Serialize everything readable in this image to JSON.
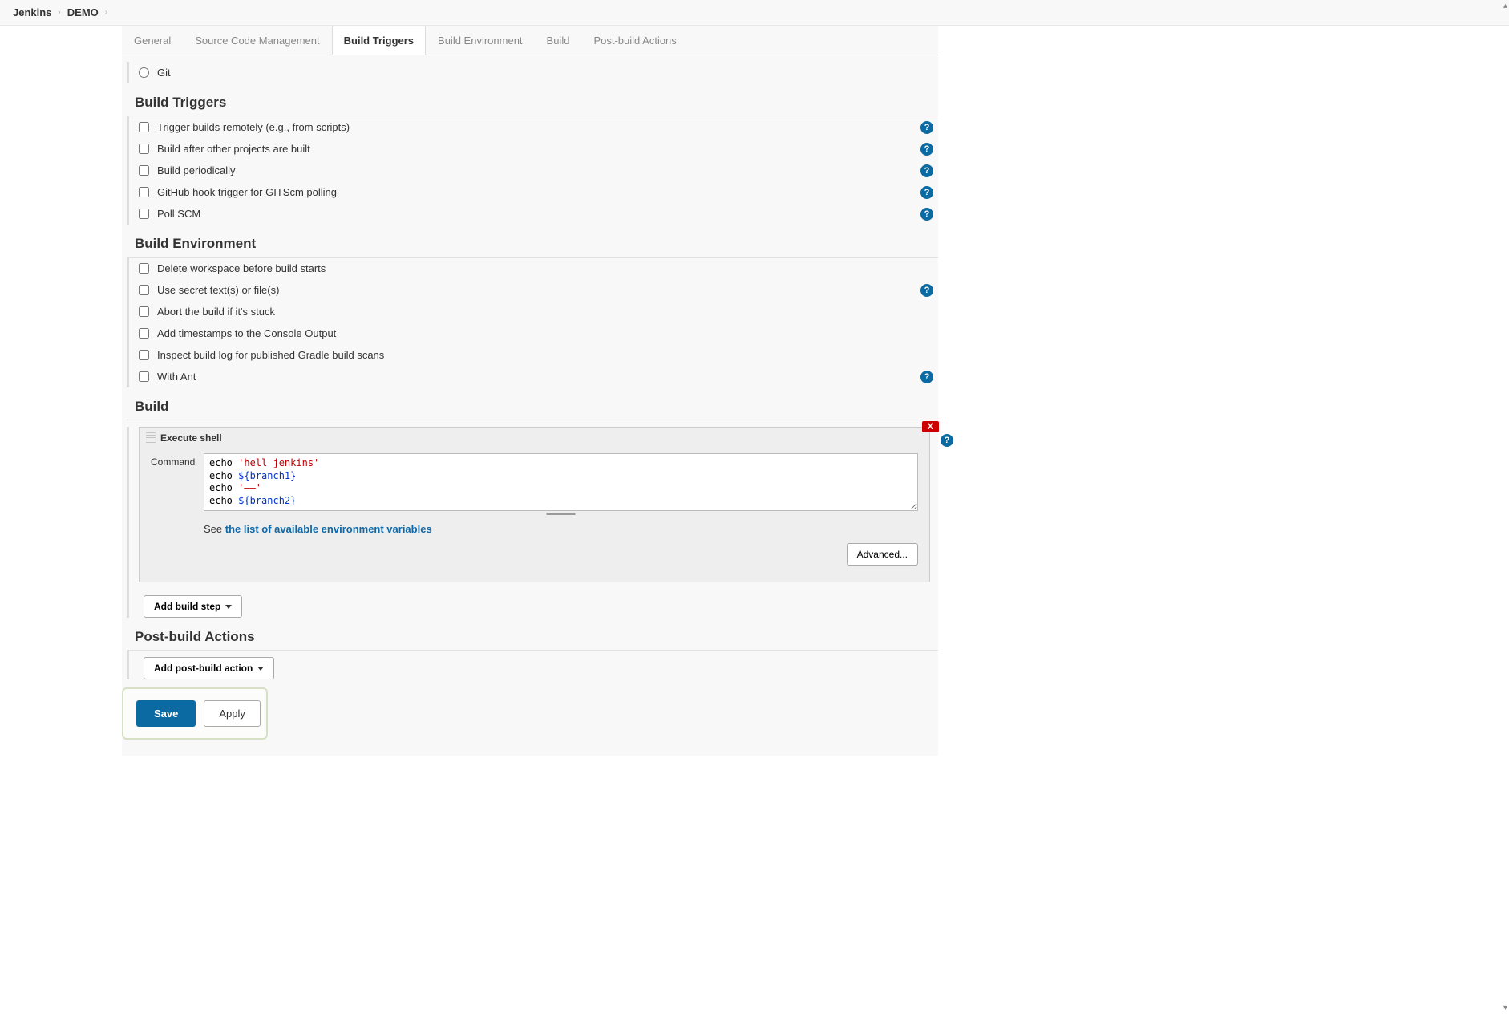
{
  "breadcrumb": {
    "root": "Jenkins",
    "project": "DEMO"
  },
  "tabs": [
    "General",
    "Source Code Management",
    "Build Triggers",
    "Build Environment",
    "Build",
    "Post-build Actions"
  ],
  "active_tab": "Build Triggers",
  "scm_git_label": "Git",
  "sections": {
    "build_triggers": {
      "title": "Build Triggers",
      "options": [
        {
          "label": "Trigger builds remotely (e.g., from scripts)",
          "help": true
        },
        {
          "label": "Build after other projects are built",
          "help": true
        },
        {
          "label": "Build periodically",
          "help": true
        },
        {
          "label": "GitHub hook trigger for GITScm polling",
          "help": true
        },
        {
          "label": "Poll SCM",
          "help": true
        }
      ]
    },
    "build_env": {
      "title": "Build Environment",
      "options": [
        {
          "label": "Delete workspace before build starts",
          "help": false
        },
        {
          "label": "Use secret text(s) or file(s)",
          "help": true
        },
        {
          "label": "Abort the build if it's stuck",
          "help": false
        },
        {
          "label": "Add timestamps to the Console Output",
          "help": false
        },
        {
          "label": "Inspect build log for published Gradle build scans",
          "help": false
        },
        {
          "label": "With Ant",
          "help": true
        }
      ]
    },
    "build": {
      "title": "Build",
      "step_title": "Execute shell",
      "command_label": "Command",
      "command_lines": [
        {
          "prefix": "echo ",
          "rest_type": "str",
          "rest": "'hell jenkins'"
        },
        {
          "prefix": "echo ",
          "rest_type": "var",
          "rest": "${branch1}"
        },
        {
          "prefix": "echo ",
          "rest_type": "str",
          "rest": "'——'"
        },
        {
          "prefix": "echo ",
          "rest_type": "var",
          "rest": "${branch2}"
        }
      ],
      "env_vars_prefix": "See ",
      "env_vars_link": "the list of available environment variables",
      "advanced_label": "Advanced...",
      "add_step_label": "Add build step",
      "delete_label": "X"
    },
    "post_build": {
      "title": "Post-build Actions",
      "add_action_label": "Add post-build action"
    }
  },
  "buttons": {
    "save": "Save",
    "apply": "Apply"
  }
}
